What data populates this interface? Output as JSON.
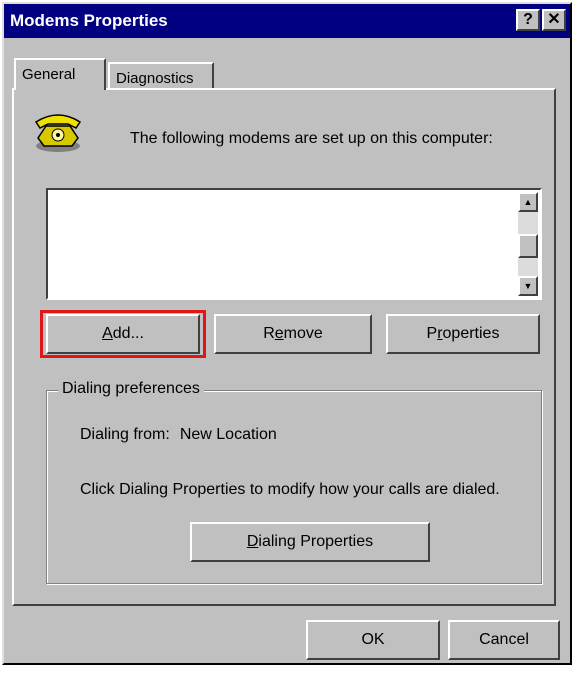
{
  "window": {
    "title": "Modems Properties",
    "help_label": "?",
    "close_label": "✕"
  },
  "tabs": [
    {
      "label": "General"
    },
    {
      "label": "Diagnostics"
    }
  ],
  "general": {
    "heading": "The following modems are set up on this computer:",
    "modems": [],
    "buttons": {
      "add": {
        "prefix": "",
        "accel": "A",
        "suffix": "dd..."
      },
      "remove": {
        "prefix": "R",
        "accel": "e",
        "suffix": "move"
      },
      "properties": {
        "prefix": "P",
        "accel": "r",
        "suffix": "operties"
      }
    },
    "dialing": {
      "group_label": "Dialing preferences",
      "from_label": "Dialing from:",
      "from_value": "New Location",
      "info": "Click Dialing Properties to modify how your calls are dialed.",
      "button": {
        "prefix": "",
        "accel": "D",
        "suffix": "ialing Properties"
      }
    }
  },
  "footer": {
    "ok_label": "OK",
    "cancel_label": "Cancel"
  },
  "colors": {
    "titlebar": "#000080",
    "face": "#c0c0c0",
    "highlight_box": "#e01515"
  }
}
